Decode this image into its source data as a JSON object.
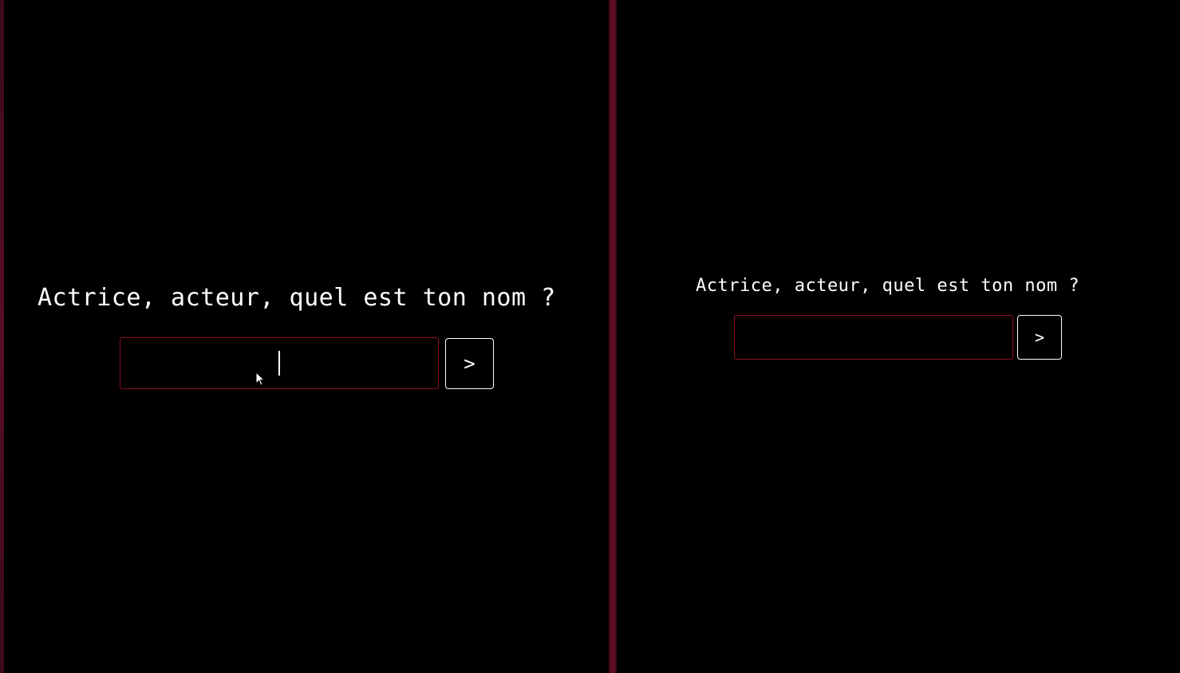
{
  "left_pane": {
    "prompt": "Actrice, acteur, quel est ton nom ?",
    "input": {
      "value": "",
      "placeholder": ""
    },
    "submit_label": ">"
  },
  "right_pane": {
    "prompt": "Actrice, acteur, quel est ton nom ?",
    "input": {
      "value": "",
      "placeholder": ""
    },
    "submit_label": ">"
  },
  "colors": {
    "background": "#000000",
    "text": "#ffffff",
    "input_border": "#8b1020",
    "button_border": "#ffffff",
    "divider": "#6b0f26"
  },
  "icons": {
    "text_caret": "text-caret-icon",
    "mouse_pointer": "mouse-pointer-icon"
  }
}
